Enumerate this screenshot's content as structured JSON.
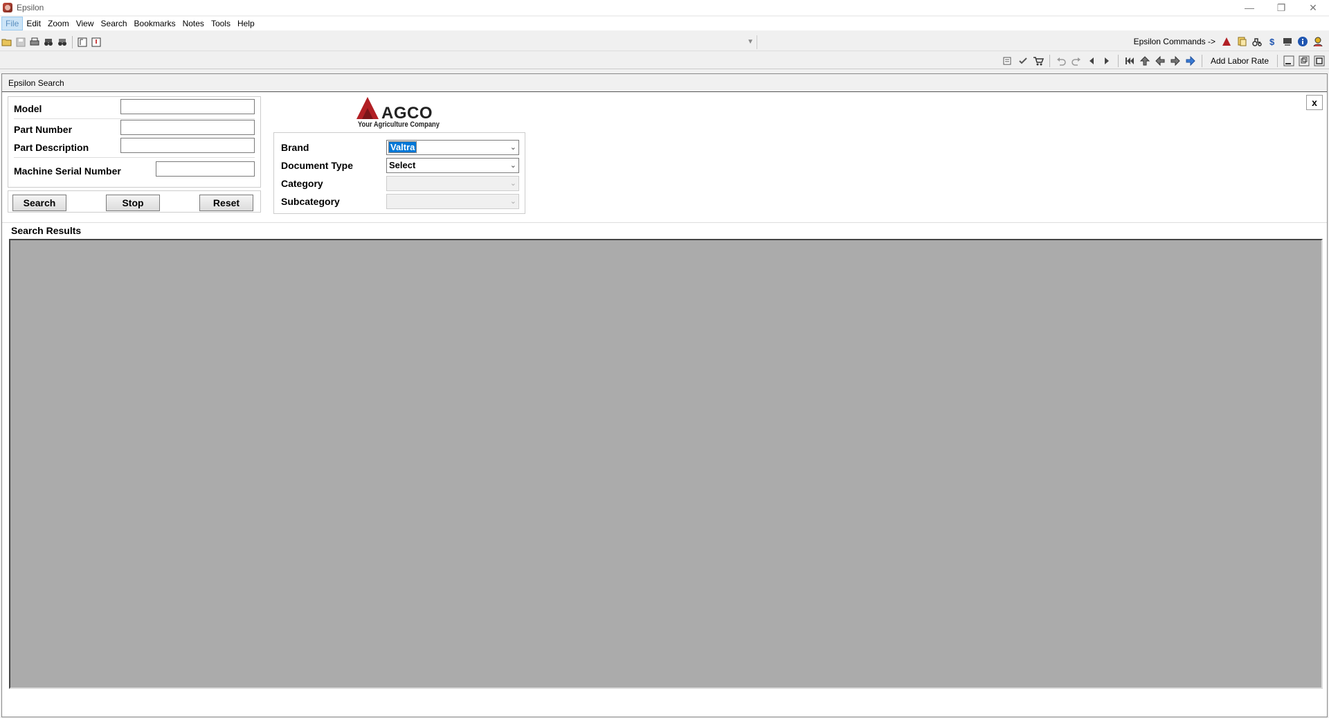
{
  "window": {
    "title": "Epsilon",
    "controls": [
      "minimize-icon",
      "restore-icon",
      "close-icon"
    ]
  },
  "menu": [
    {
      "label": "File",
      "active": true
    },
    {
      "label": "Edit"
    },
    {
      "label": "Zoom"
    },
    {
      "label": "View"
    },
    {
      "label": "Search"
    },
    {
      "label": "Bookmarks"
    },
    {
      "label": "Notes"
    },
    {
      "label": "Tools"
    },
    {
      "label": "Help"
    }
  ],
  "toolbar": {
    "epsilon_commands_label": "Epsilon Commands ->",
    "add_labor_rate_label": "Add Labor Rate"
  },
  "child_window": {
    "title": "Epsilon Search",
    "close_label": "x"
  },
  "search_form": {
    "model_label": "Model",
    "model_value": "",
    "part_number_label": "Part Number",
    "part_number_value": "",
    "part_description_label": "Part Description",
    "part_description_value": "",
    "serial_label": "Machine Serial Number",
    "serial_value": "",
    "search_button": "Search",
    "stop_button": "Stop",
    "reset_button": "Reset"
  },
  "logo": {
    "word": "AGCO",
    "tagline": "Your Agriculture Company",
    "accent": "#b11f24"
  },
  "filters": {
    "brand_label": "Brand",
    "brand_value": "Valtra",
    "document_type_label": "Document Type",
    "document_type_value": "Select",
    "category_label": "Category",
    "category_value": "",
    "subcategory_label": "Subcategory",
    "subcategory_value": ""
  },
  "results": {
    "label": "Search Results"
  }
}
